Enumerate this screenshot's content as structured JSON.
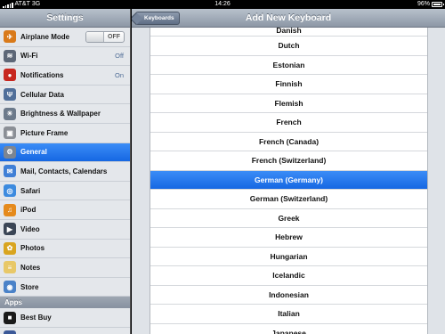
{
  "status": {
    "carrier": "AT&T",
    "network": "3G",
    "time": "14:26",
    "battery": "96%"
  },
  "settings": {
    "title": "Settings",
    "rows": [
      {
        "label": "Airplane Mode",
        "icon": "airplane-icon",
        "color": "#d97a1a",
        "glyph": "✈",
        "toggle": "OFF"
      },
      {
        "label": "Wi-Fi",
        "icon": "wifi-icon",
        "color": "#5d6777",
        "glyph": "≋",
        "value": "Off"
      },
      {
        "label": "Notifications",
        "icon": "notifications-icon",
        "color": "#c7271f",
        "glyph": "●",
        "value": "On"
      },
      {
        "label": "Cellular Data",
        "icon": "cellular-icon",
        "color": "#4f6e99",
        "glyph": "Ψ"
      },
      {
        "label": "Brightness & Wallpaper",
        "icon": "brightness-icon",
        "color": "#6c7a8b",
        "glyph": "☀"
      },
      {
        "label": "Picture Frame",
        "icon": "picture-frame-icon",
        "color": "#8b8f96",
        "glyph": "▣"
      },
      {
        "label": "General",
        "icon": "gear-icon",
        "color": "#7c8592",
        "glyph": "⚙",
        "selected": true
      },
      {
        "label": "Mail, Contacts, Calendars",
        "icon": "mail-icon",
        "color": "#3f7fd6",
        "glyph": "✉"
      },
      {
        "label": "Safari",
        "icon": "safari-icon",
        "color": "#3d8bdf",
        "glyph": "◎"
      },
      {
        "label": "iPod",
        "icon": "ipod-icon",
        "color": "#e58a1c",
        "glyph": "♫"
      },
      {
        "label": "Video",
        "icon": "video-icon",
        "color": "#3b4656",
        "glyph": "▶"
      },
      {
        "label": "Photos",
        "icon": "photos-icon",
        "color": "#d9a520",
        "glyph": "✿"
      },
      {
        "label": "Notes",
        "icon": "notes-icon",
        "color": "#e8c868",
        "glyph": "≡"
      },
      {
        "label": "Store",
        "icon": "store-icon",
        "color": "#4a82c8",
        "glyph": "◉"
      }
    ],
    "apps_header": "Apps",
    "app_rows": [
      {
        "label": "Best Buy",
        "icon": "best-buy-icon",
        "color": "#1a1a1a",
        "glyph": "■"
      },
      {
        "label": "Facebook",
        "icon": "facebook-icon",
        "color": "#3b5998",
        "glyph": "f"
      }
    ]
  },
  "keyboard": {
    "back_label": "Keyboards",
    "title": "Add New Keyboard",
    "items": [
      {
        "label": "Danish",
        "partial": true
      },
      {
        "label": "Dutch"
      },
      {
        "label": "Estonian"
      },
      {
        "label": "Finnish"
      },
      {
        "label": "Flemish"
      },
      {
        "label": "French"
      },
      {
        "label": "French (Canada)"
      },
      {
        "label": "French (Switzerland)"
      },
      {
        "label": "German (Germany)",
        "selected": true
      },
      {
        "label": "German (Switzerland)"
      },
      {
        "label": "Greek"
      },
      {
        "label": "Hebrew"
      },
      {
        "label": "Hungarian"
      },
      {
        "label": "Icelandic"
      },
      {
        "label": "Indonesian"
      },
      {
        "label": "Italian"
      },
      {
        "label": "Japanese"
      }
    ]
  }
}
